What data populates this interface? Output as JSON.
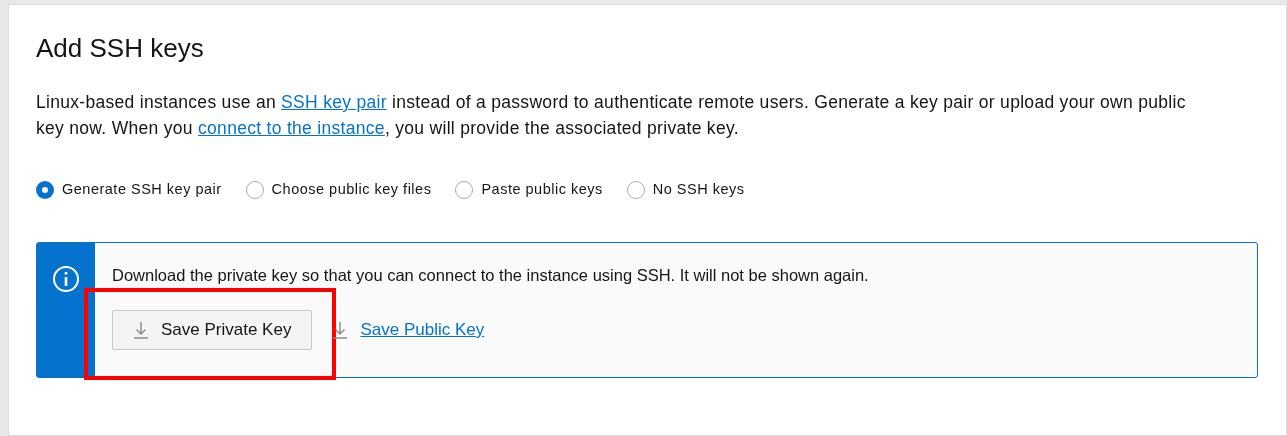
{
  "title": "Add SSH keys",
  "description": [
    {
      "kind": "text",
      "text": "Linux-based instances use an "
    },
    {
      "kind": "link",
      "text": "SSH key pair"
    },
    {
      "kind": "text",
      "text": " instead of a password to authenticate remote users. Generate a key pair or upload your own public key now. When you "
    },
    {
      "kind": "link",
      "text": "connect to the instance"
    },
    {
      "kind": "text",
      "text": ", you will provide the associated private key."
    }
  ],
  "options": [
    {
      "label": "Generate SSH key pair",
      "selected": true
    },
    {
      "label": "Choose public key files",
      "selected": false
    },
    {
      "label": "Paste public keys",
      "selected": false
    },
    {
      "label": "No SSH keys",
      "selected": false
    }
  ],
  "notice": {
    "message": "Download the private key so that you can connect to the instance using SSH. It will not be shown again.",
    "actions": [
      {
        "kind": "button",
        "label": "Save Private Key",
        "highlighted": true
      },
      {
        "kind": "link",
        "label": "Save Public Key",
        "highlighted": false
      }
    ]
  }
}
